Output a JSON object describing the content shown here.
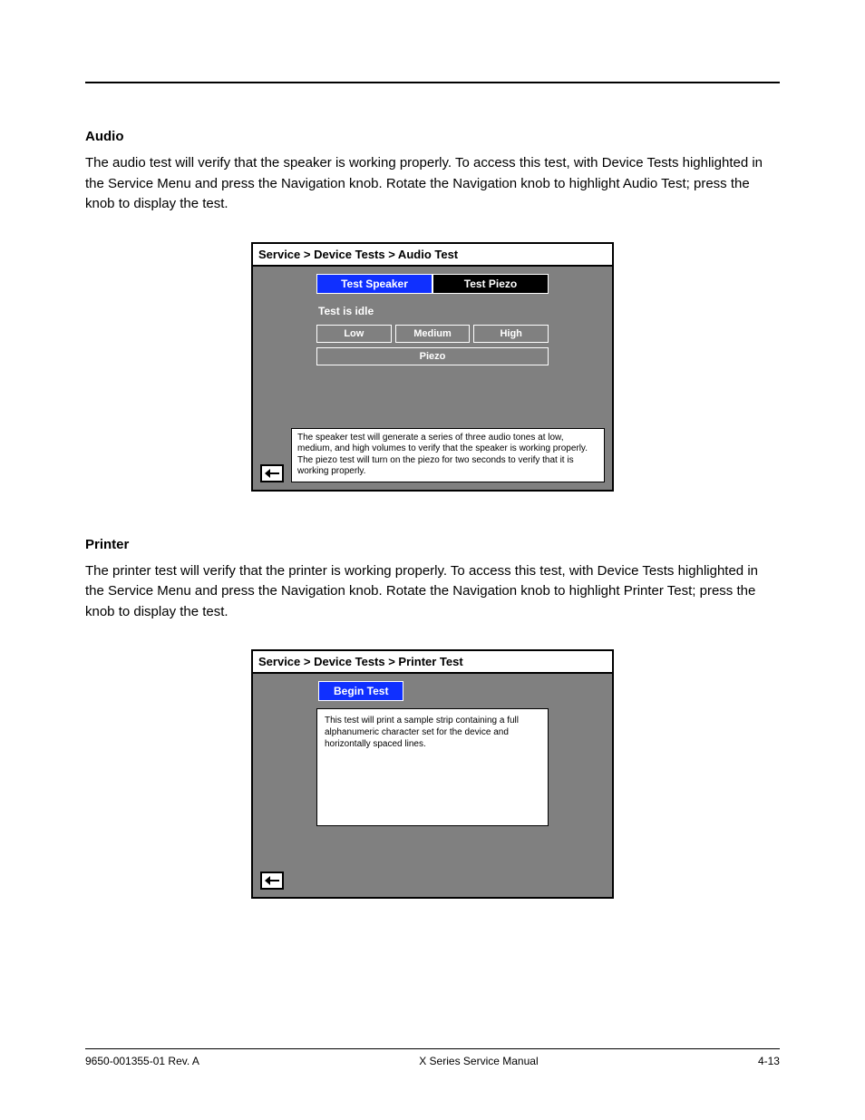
{
  "sections": {
    "audio": {
      "heading": "Audio",
      "body": "The audio test will verify that the speaker is working properly. To access this test, with Device Tests highlighted in the Service Menu and press the Navigation knob. Rotate the Navigation knob to highlight Audio Test; press the knob to display the test."
    },
    "printer": {
      "heading": "Printer",
      "body": "The printer test will verify that the printer is working properly. To access this test, with Device Tests highlighted in the Service Menu and press the Navigation knob. Rotate the Navigation knob to highlight Printer Test; press the knob to display the test."
    }
  },
  "audio_screen": {
    "breadcrumb": "Service > Device Tests > Audio Test",
    "tabs": {
      "speaker": "Test Speaker",
      "piezo": "Test Piezo"
    },
    "status": "Test is idle",
    "volumes": {
      "low": "Low",
      "medium": "Medium",
      "high": "High"
    },
    "piezo_btn": "Piezo",
    "info": "The speaker test will generate a series of three audio tones at low, medium, and high volumes to verify that the speaker is working properly.  The piezo test will turn on the piezo for two seconds to verify that it is working properly."
  },
  "printer_screen": {
    "breadcrumb": "Service > Device Tests > Printer Test",
    "begin": "Begin Test",
    "info": "This test will print a sample strip containing a full alphanumeric character set for the device and horizontally spaced lines."
  },
  "footer": {
    "rev": "9650-001355-01 Rev. A",
    "product": "X Series Service Manual",
    "page": "4-13"
  }
}
